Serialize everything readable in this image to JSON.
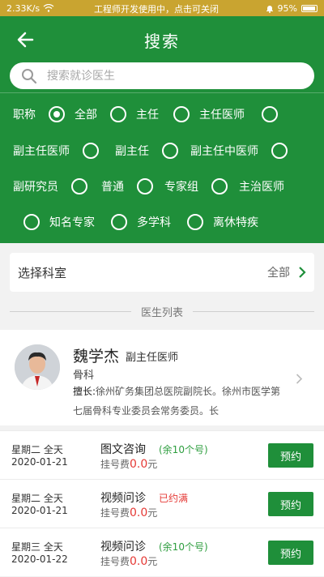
{
  "status_bar": {
    "speed": "2.33K/s",
    "notice": "工程师开发使用中，点击可关闭",
    "battery": "95%"
  },
  "nav": {
    "title": "搜索"
  },
  "search": {
    "placeholder": "搜索就诊医生"
  },
  "filters": {
    "title": "职称",
    "options": [
      {
        "label": "全部",
        "checked": true
      },
      {
        "label": "主任",
        "checked": false
      },
      {
        "label": "主任医师",
        "checked": false
      },
      {
        "label": "",
        "checked": false
      },
      {
        "label": "副主任医师",
        "checked": false
      },
      {
        "label": "副主任",
        "checked": false
      },
      {
        "label": "副主任中医师",
        "checked": false
      },
      {
        "label": "",
        "checked": false
      },
      {
        "label": "副研究员",
        "checked": false
      },
      {
        "label": "普通",
        "checked": false
      },
      {
        "label": "专家组",
        "checked": false
      },
      {
        "label": "主治医师",
        "checked": false
      },
      {
        "label": "知名专家",
        "checked": false
      },
      {
        "label": "多学科",
        "checked": false
      },
      {
        "label": "离休特疾",
        "checked": false
      }
    ]
  },
  "department": {
    "label": "选择科室",
    "value": "全部"
  },
  "list_title": "医生列表",
  "doctor": {
    "name": "魏学杰",
    "title": "副主任医师",
    "dept": "骨科",
    "desc_prefix": "擅长:",
    "desc": "徐州矿务集团总医院副院长。徐州市医学第七届骨科专业委员会常务委员。长"
  },
  "schedules": [
    {
      "day": "星期二 全天",
      "date": "2020-01-21",
      "type": "图文咨询",
      "status": "(余10个号)",
      "status_color": "#2e9e3f",
      "fee_label": "挂号费",
      "fee": "0.0",
      "fee_unit": "元",
      "button": "预约"
    },
    {
      "day": "星期二 全天",
      "date": "2020-01-21",
      "type": "视频问诊",
      "status": "已约满",
      "status_color": "#e53935",
      "fee_label": "挂号费",
      "fee": "0.0",
      "fee_unit": "元",
      "button": "预约"
    },
    {
      "day": "星期三 全天",
      "date": "2020-01-22",
      "type": "视频问诊",
      "status": "(余10个号)",
      "status_color": "#2e9e3f",
      "fee_label": "挂号费",
      "fee": "0.0",
      "fee_unit": "元",
      "button": "预约"
    }
  ],
  "colors": {
    "primary": "#1f8f3a",
    "status_bar": "#c9a430",
    "fee": "#e53935"
  }
}
